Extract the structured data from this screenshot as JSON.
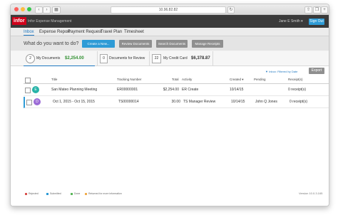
{
  "browser": {
    "url": "10.96.82.82"
  },
  "app": {
    "logo": "infor",
    "name": "Infor Expense Management",
    "user": "Jane E Smith",
    "signout": "Sign Out"
  },
  "tabs": [
    {
      "label": "Inbox"
    },
    {
      "label": "Expense Report"
    },
    {
      "label": "Payment Request"
    },
    {
      "label": "Travel Plan"
    },
    {
      "label": "Timesheet"
    }
  ],
  "toolbar": {
    "question": "What do you want to do?",
    "buttons": [
      {
        "label": "Create a New..."
      },
      {
        "label": "Review Documents"
      },
      {
        "label": "Search Documents"
      },
      {
        "label": "Manage Receipts"
      }
    ]
  },
  "summary": {
    "my_docs_count": "2",
    "my_docs_label": "My Documents",
    "my_docs_amount": "$2,254.00",
    "review_count": "0",
    "review_label": "Documents for Review",
    "cc_count": "22",
    "cc_label": "My Credit Card",
    "cc_amount": "$6,378.87"
  },
  "list": {
    "filter_label": "Inbox: Filtered by Date",
    "export_label": "Export",
    "columns": {
      "title": "Title",
      "tracking": "Tracking Number",
      "total": "Total",
      "activity": "Activity",
      "created": "Created",
      "pending": "Pending",
      "receipts": "Receipt(s)"
    },
    "rows": [
      {
        "icon_letter": "E",
        "title": "San Mateo Planning Meeting",
        "tracking": "ER00000001",
        "total": "$2,254.00",
        "activity": "ER Create",
        "created": "10/14/15",
        "pending": "",
        "receipts": "0 receipt(s)"
      },
      {
        "icon_letter": "D",
        "title": "Oct 1, 2015 - Oct 15, 2015",
        "tracking": "TS00000014",
        "total": "30.00",
        "activity": "TS Manager Review",
        "created": "10/14/15",
        "pending": "John Q Jones",
        "receipts": "0 receipt(s)"
      }
    ]
  },
  "legend": [
    {
      "label": "Rejected",
      "color": "#d9534f"
    },
    {
      "label": "Submitted",
      "color": "#2e9bd6"
    },
    {
      "label": "Done",
      "color": "#5cb85c"
    },
    {
      "label": "Returned for more information",
      "color": "#f0ad4e"
    }
  ],
  "footer": {
    "version": "Version 10.0.3.165"
  },
  "colors": {
    "accent": "#2e9bd6",
    "brand": "#d0021b",
    "appbar": "#3a3a3a",
    "amount_green": "#2f8f2f",
    "row_icon_e": "#27b3a8",
    "row_icon_d": "#9b6bd6"
  }
}
